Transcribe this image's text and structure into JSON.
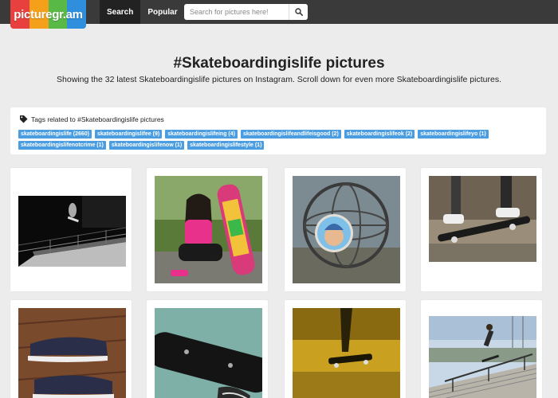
{
  "header": {
    "logo_text": "picturegr.am",
    "logo_colors": [
      "#e8403e",
      "#f4a01b",
      "#58b947",
      "#2f8fdc"
    ],
    "nav": [
      {
        "label": "Search",
        "active": true
      },
      {
        "label": "Popular",
        "active": false
      }
    ],
    "search": {
      "placeholder": "Search for pictures here!",
      "value": "",
      "button_icon": "search-icon"
    }
  },
  "page": {
    "title": "#Skateboardingislife pictures",
    "subtitle": "Showing the 32 latest Skateboardingislife pictures on Instagram. Scroll down for even more Skateboardingislife pictures."
  },
  "tags": {
    "header": "Tags related to #Skateboardingislife pictures",
    "header_icon": "tag-icon",
    "row1": [
      "skateboardingislife (2660)",
      "skateboardingislifee (9)",
      "skateboardingislifeing (4)",
      "skateboardingislifeandlifeisgood (2)",
      "skateboardingislifeok (2)",
      "skateboardingislifeyo (1)"
    ],
    "row2": [
      "skateboardingislifenotcrime (1)",
      "skateboardingislifenow (1)",
      "skateboardingislifestyle (1)"
    ],
    "accent_color": "#4a9de0"
  }
}
